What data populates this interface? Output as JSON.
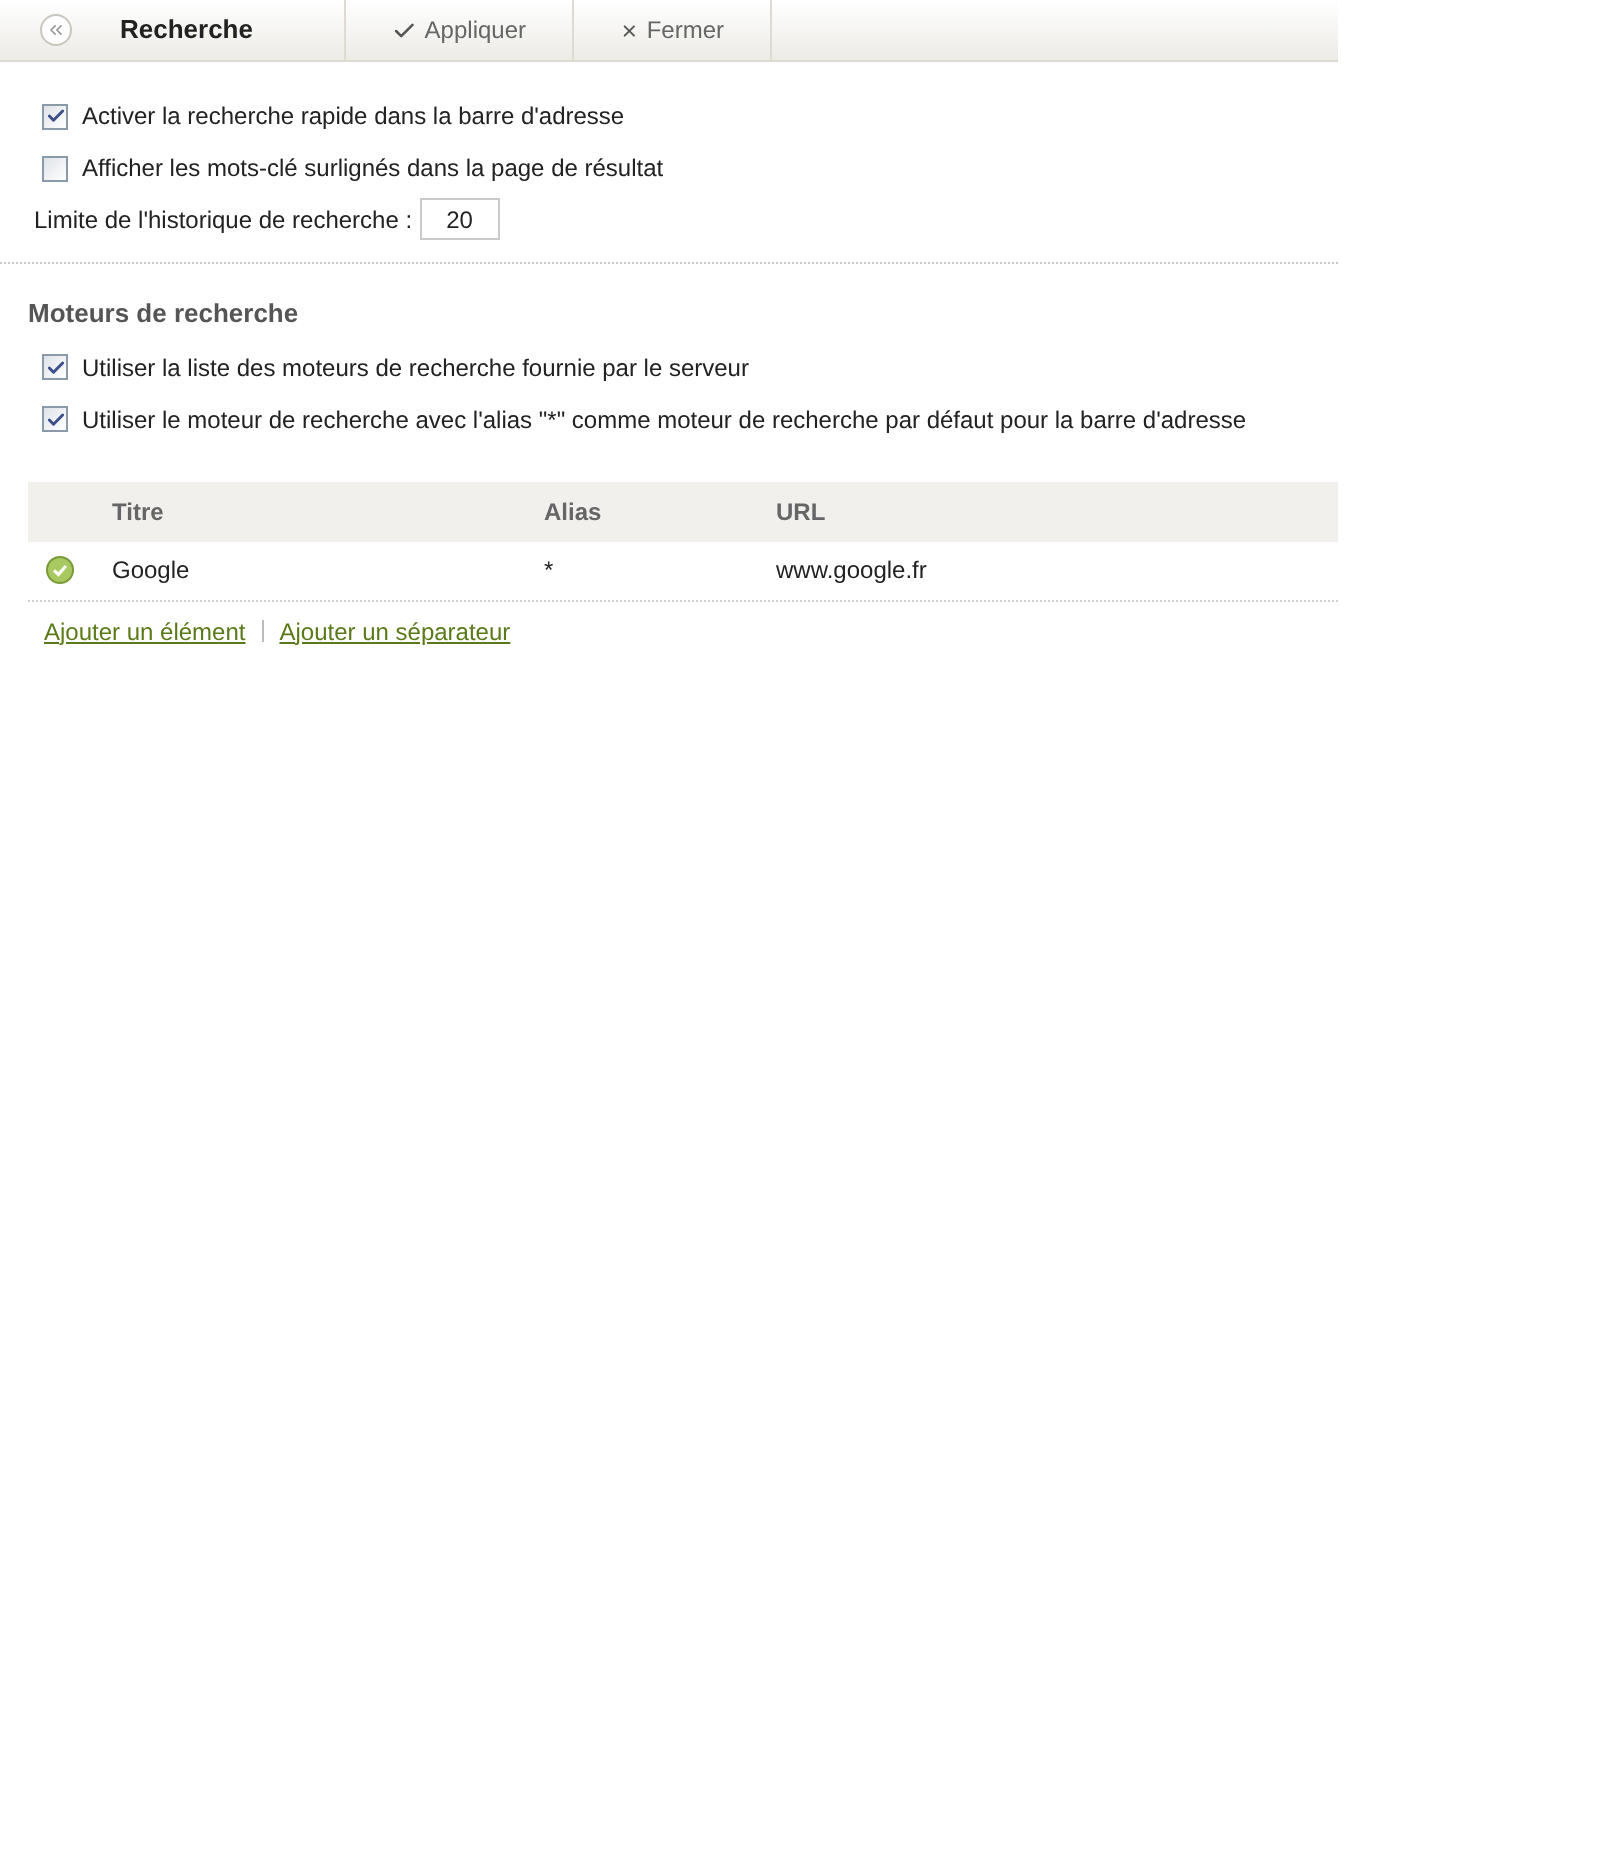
{
  "toolbar": {
    "title": "Recherche",
    "buttons": [
      {
        "kind": "apply",
        "label": "Appliquer"
      },
      {
        "kind": "close",
        "label": "Fermer"
      }
    ]
  },
  "options": [
    {
      "label": "Activer la recherche rapide dans la barre d'adresse",
      "checked": true
    },
    {
      "label": "Afficher les mots-clé surlignés dans la page de résultat",
      "checked": false
    }
  ],
  "history_limit": {
    "label": "Limite de l'historique de recherche :",
    "value": "20"
  },
  "engines_section": {
    "heading": "Moteurs de recherche",
    "options": [
      {
        "label": "Utiliser la liste des moteurs de recherche fournie par le serveur",
        "checked": true
      },
      {
        "label": "Utiliser le moteur de recherche avec l'alias \"*\" comme moteur de recherche par défaut pour la barre d'adresse",
        "checked": true
      }
    ]
  },
  "table": {
    "columns": [
      "Titre",
      "Alias",
      "URL"
    ],
    "rows": [
      {
        "title": "Google",
        "alias": "*",
        "url": "www.google.fr"
      }
    ]
  },
  "links": [
    "Ajouter un élément",
    "Ajouter un séparateur"
  ]
}
